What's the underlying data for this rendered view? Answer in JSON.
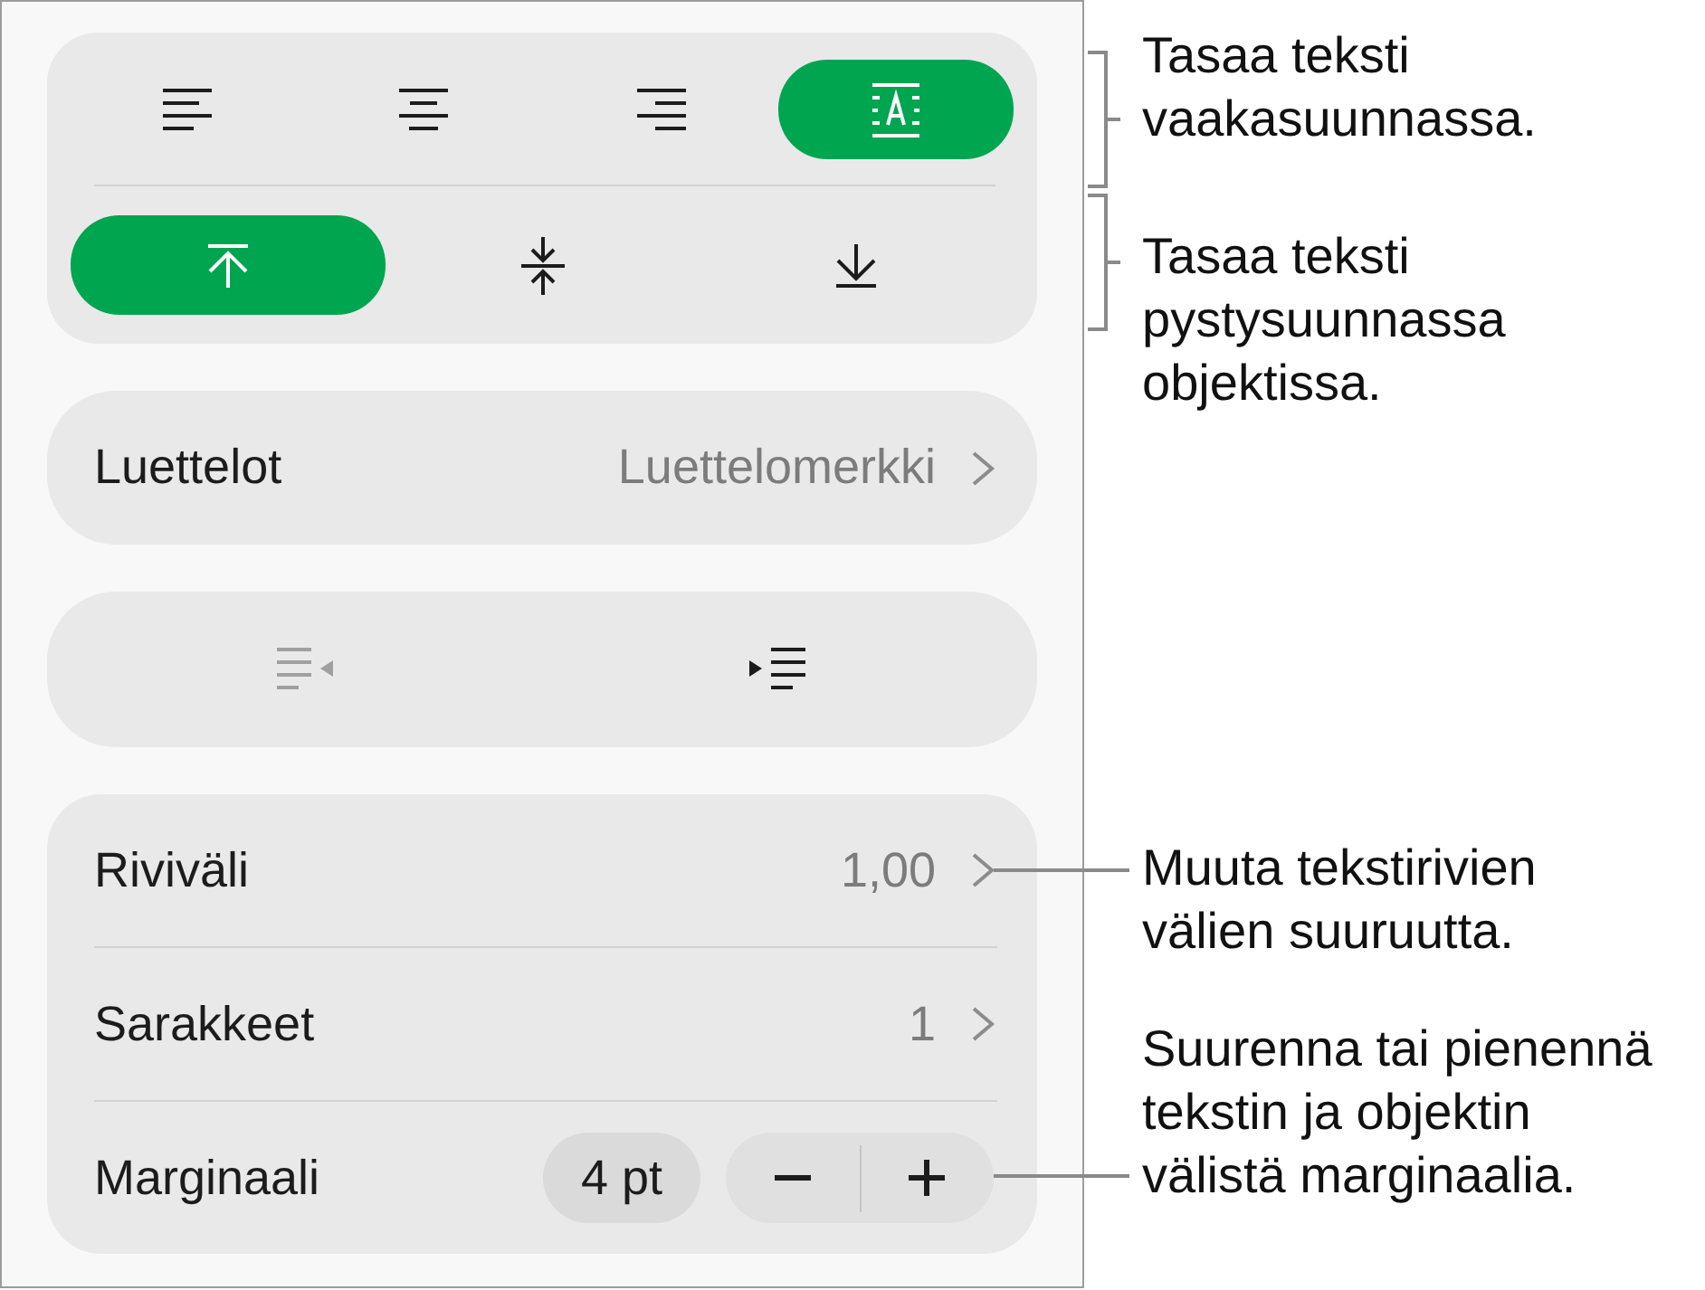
{
  "horizontal_alignment": [
    {
      "kind": "left",
      "selected": false
    },
    {
      "kind": "center",
      "selected": false
    },
    {
      "kind": "right",
      "selected": false
    },
    {
      "kind": "justify",
      "selected": true
    }
  ],
  "vertical_alignment": [
    {
      "kind": "top",
      "selected": true
    },
    {
      "kind": "middle",
      "selected": false
    },
    {
      "kind": "bottom",
      "selected": false
    }
  ],
  "lists_row": {
    "label": "Luettelot",
    "value": "Luettelomerkki"
  },
  "indent_buttons": [
    {
      "kind": "decrease",
      "disabled": true
    },
    {
      "kind": "increase",
      "disabled": false
    }
  ],
  "settings_rows": [
    {
      "kind": "link",
      "label": "Riviväli",
      "value": "1,00"
    },
    {
      "kind": "link",
      "label": "Sarakkeet",
      "value": "1"
    },
    {
      "kind": "stepper",
      "label": "Marginaali",
      "value": "4 pt"
    }
  ],
  "callouts": [
    {
      "kind": "bracket",
      "text": "Tasaa teksti vaakasuunnassa."
    },
    {
      "kind": "bracket",
      "text": "Tasaa teksti pystysuunnassa objektissa."
    },
    {
      "kind": "leader",
      "text": "Muuta tekstirivien välien suuruutta."
    },
    {
      "kind": "leader",
      "text": "Suurenna tai pienennä tekstin ja objektin välistä marginaalia."
    }
  ]
}
